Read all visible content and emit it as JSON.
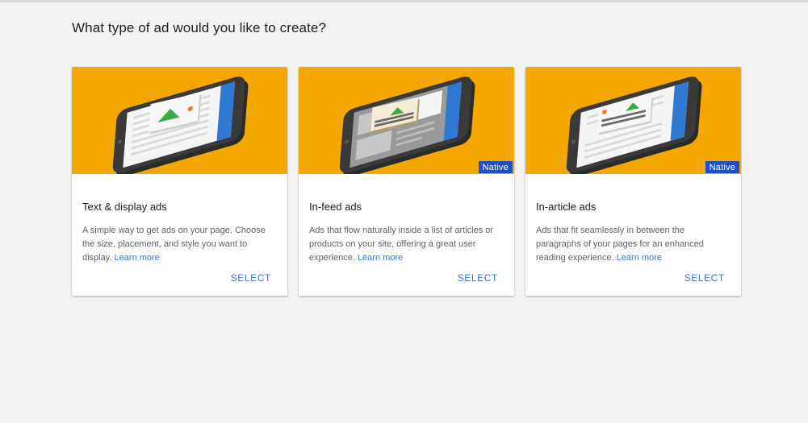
{
  "page": {
    "title": "What type of ad would you like to create?"
  },
  "colors": {
    "hero_background": "#f4a700",
    "badge_background": "#1f4fc4",
    "link": "#3b6fd1",
    "phone_body": "#3a3a3a",
    "phone_header": "#2f78d4",
    "ad_image_icon": "#3bab48",
    "ad_dot": "#f27a1a"
  },
  "cards": [
    {
      "title": "Text & display ads",
      "description": "A simple way to get ads on your page. Choose the size, placement, and style you want to display.",
      "learn_more": "Learn more",
      "select_label": "SELECT",
      "badge": "",
      "illustration": "phone-display-ad-icon"
    },
    {
      "title": "In-feed ads",
      "description": "Ads that flow naturally inside a list of articles or products on your site, offering a great user experience.",
      "learn_more": "Learn more",
      "select_label": "SELECT",
      "badge": "Native",
      "illustration": "phone-infeed-ad-icon"
    },
    {
      "title": "In-article ads",
      "description": "Ads that fit seamlessly in between the paragraphs of your pages for an enhanced reading experience.",
      "learn_more": "Learn more",
      "select_label": "SELECT",
      "badge": "Native",
      "illustration": "phone-inarticle-ad-icon"
    }
  ]
}
